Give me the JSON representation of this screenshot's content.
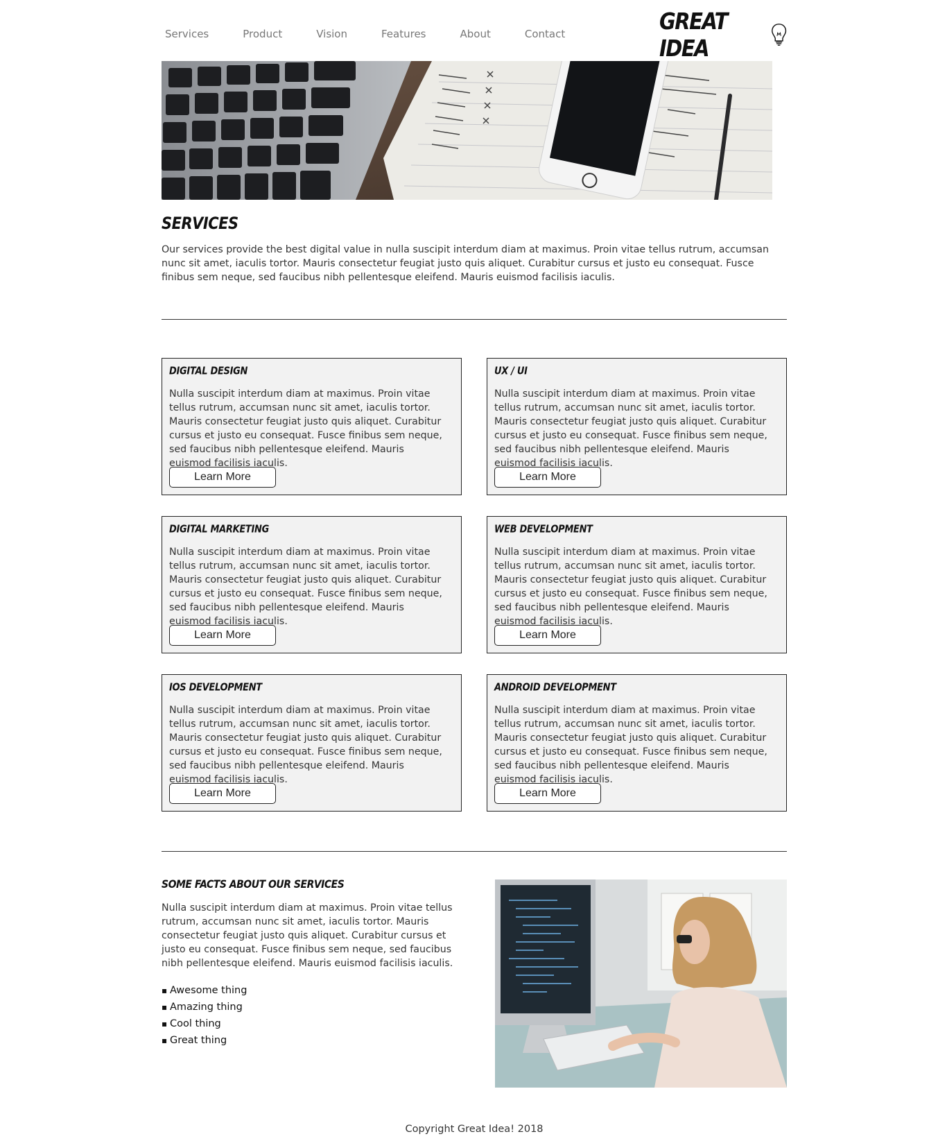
{
  "nav": {
    "items": [
      "Services",
      "Product",
      "Vision",
      "Features",
      "About",
      "Contact"
    ]
  },
  "logo": {
    "text": "GREAT IDEA",
    "icon": "lightbulb-icon"
  },
  "hero": {
    "image": "laptop-phone-notebook-photo"
  },
  "services": {
    "title": "SERVICES",
    "intro": "Our services provide the best digital value in nulla suscipit interdum diam at maximus. Proin vitae tellus rutrum, accumsan nunc sit amet, iaculis tortor. Mauris consectetur feugiat justo quis aliquet. Curabitur cursus et justo eu consequat. Fusce finibus sem neque, sed faucibus nibh pellentesque eleifend. Mauris euismod facilisis iaculis."
  },
  "cards": [
    {
      "title": "DIGITAL DESIGN",
      "text": "Nulla suscipit interdum diam at maximus. Proin vitae tellus rutrum, accumsan nunc sit amet, iaculis tortor. Mauris consectetur feugiat justo quis aliquet. Curabitur cursus et justo eu consequat. Fusce finibus sem neque, sed faucibus nibh pellentesque eleifend. Mauris euismod facilisis iaculis.",
      "button": "Learn More"
    },
    {
      "title": "UX / UI",
      "text": "Nulla suscipit interdum diam at maximus. Proin vitae tellus rutrum, accumsan nunc sit amet, iaculis tortor. Mauris consectetur feugiat justo quis aliquet. Curabitur cursus et justo eu consequat. Fusce finibus sem neque, sed faucibus nibh pellentesque eleifend. Mauris euismod facilisis iaculis.",
      "button": "Learn More"
    },
    {
      "title": "DIGITAL MARKETING",
      "text": "Nulla suscipit interdum diam at maximus. Proin vitae tellus rutrum, accumsan nunc sit amet, iaculis tortor. Mauris consectetur feugiat justo quis aliquet. Curabitur cursus et justo eu consequat. Fusce finibus sem neque, sed faucibus nibh pellentesque eleifend. Mauris euismod facilisis iaculis.",
      "button": "Learn More"
    },
    {
      "title": "WEB DEVELOPMENT",
      "text": "Nulla suscipit interdum diam at maximus. Proin vitae tellus rutrum, accumsan nunc sit amet, iaculis tortor. Mauris consectetur feugiat justo quis aliquet. Curabitur cursus et justo eu consequat. Fusce finibus sem neque, sed faucibus nibh pellentesque eleifend. Mauris euismod facilisis iaculis.",
      "button": "Learn More"
    },
    {
      "title": "IOS DEVELOPMENT",
      "text": "Nulla suscipit interdum diam at maximus. Proin vitae tellus rutrum, accumsan nunc sit amet, iaculis tortor. Mauris consectetur feugiat justo quis aliquet. Curabitur cursus et justo eu consequat. Fusce finibus sem neque, sed faucibus nibh pellentesque eleifend. Mauris euismod facilisis iaculis.",
      "button": "Learn More"
    },
    {
      "title": "ANDROID DEVELOPMENT",
      "text": "Nulla suscipit interdum diam at maximus. Proin vitae tellus rutrum, accumsan nunc sit amet, iaculis tortor. Mauris consectetur feugiat justo quis aliquet. Curabitur cursus et justo eu consequat. Fusce finibus sem neque, sed faucibus nibh pellentesque eleifend. Mauris euismod facilisis iaculis.",
      "button": "Learn More"
    }
  ],
  "facts": {
    "title": "SOME FACTS ABOUT OUR SERVICES",
    "text": "Nulla suscipit interdum diam at maximus. Proin vitae tellus rutrum, accumsan nunc sit amet, iaculis tortor. Mauris consectetur feugiat justo quis aliquet. Curabitur cursus et justo eu consequat. Fusce finibus sem neque, sed faucibus nibh pellentesque eleifend. Mauris euismod facilisis iaculis.",
    "list": [
      "Awesome thing",
      "Amazing thing",
      "Cool thing",
      "Great thing"
    ],
    "image": "woman-coding-at-computer-photo"
  },
  "footer": {
    "copyright": "Copyright Great Idea! 2018"
  },
  "colors": {
    "text": "#333333",
    "nav": "#777777",
    "card_bg": "#f2f2f2",
    "border": "#222222"
  }
}
